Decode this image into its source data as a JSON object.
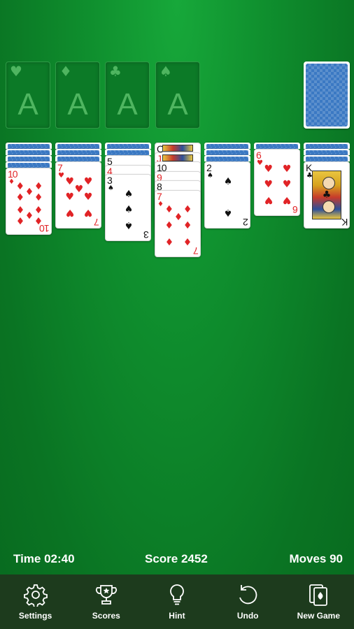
{
  "foundations": [
    {
      "suit": "♥",
      "rank": "A"
    },
    {
      "suit": "♦",
      "rank": "A"
    },
    {
      "suit": "♣",
      "rank": "A"
    },
    {
      "suit": "♠",
      "rank": "A"
    }
  ],
  "tableau": [
    {
      "facedown": 4,
      "cards": [
        {
          "rank": "10",
          "suit": "♦",
          "color": "red"
        }
      ]
    },
    {
      "facedown": 3,
      "cards": [
        {
          "rank": "7",
          "suit": "♥",
          "color": "red"
        }
      ]
    },
    {
      "facedown": 2,
      "cards": [
        {
          "rank": "5",
          "suit": "♠",
          "color": "black"
        },
        {
          "rank": "4",
          "suit": "♦",
          "color": "red"
        },
        {
          "rank": "3",
          "suit": "♠",
          "color": "black"
        }
      ]
    },
    {
      "facedown": 0,
      "cards": [
        {
          "rank": "Q",
          "suit": "♠",
          "color": "black"
        },
        {
          "rank": "J",
          "suit": "♦",
          "color": "red"
        },
        {
          "rank": "10",
          "suit": "♠",
          "color": "black"
        },
        {
          "rank": "9",
          "suit": "♦",
          "color": "red"
        },
        {
          "rank": "8",
          "suit": "♠",
          "color": "black"
        },
        {
          "rank": "7",
          "suit": "♦",
          "color": "red"
        }
      ]
    },
    {
      "facedown": 3,
      "cards": [
        {
          "rank": "2",
          "suit": "♠",
          "color": "black"
        }
      ]
    },
    {
      "facedown": 1,
      "cards": [
        {
          "rank": "6",
          "suit": "♥",
          "color": "red"
        }
      ]
    },
    {
      "facedown": 3,
      "cards": [
        {
          "rank": "K",
          "suit": "♣",
          "color": "black"
        }
      ]
    }
  ],
  "stats": {
    "time": "Time 02:40",
    "score": "Score 2452",
    "moves": "Moves 90"
  },
  "toolbar": {
    "settings": "Settings",
    "scores": "Scores",
    "hint": "Hint",
    "undo": "Undo",
    "new_game": "New Game"
  },
  "colors": {
    "felt": "#0f8f2e",
    "card_back": "#3b79c3",
    "red_suit": "#e12326",
    "toolbar": "#1d3b1d"
  }
}
